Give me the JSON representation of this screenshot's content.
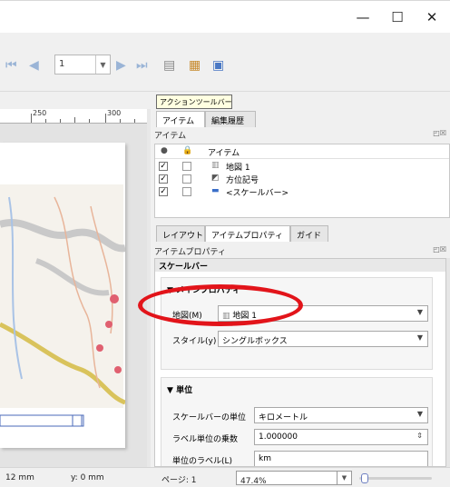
{
  "window": {
    "minimize_glyph": "—",
    "maximize_glyph": "☐",
    "close_glyph": "✕"
  },
  "toolbar": {
    "page_value": "1",
    "icons": [
      "first-page-icon",
      "previous-page-icon",
      "next-page-icon",
      "last-page-icon",
      "print-icon",
      "atlas-export-icon",
      "atlas-settings-icon"
    ]
  },
  "tooltip": {
    "text": "アクションツールバー"
  },
  "ruler": {
    "labels": [
      "250",
      "300"
    ]
  },
  "items_panel": {
    "tabs": [
      "アイテム",
      "編集履歴"
    ],
    "title": "アイテム",
    "column_header": "アイテム",
    "rows": [
      {
        "label": "地図 1",
        "icon": "map-item-icon",
        "visible": "✓"
      },
      {
        "label": "方位記号",
        "icon": "north-arrow-item-icon",
        "visible": "✓"
      },
      {
        "label": "<スケールバー>",
        "icon": "scalebar-item-icon",
        "visible": "✓"
      }
    ]
  },
  "props_panel": {
    "tabs": [
      "レイアウト",
      "アイテムプロパティ",
      "ガイド"
    ],
    "title": "アイテムプロパティ",
    "section": "スケールバー",
    "main_group": {
      "title": "メインプロパティ",
      "map_label": "地図(M)",
      "map_value": "地図 1",
      "style_label": "スタイル(y)",
      "style_value": "シングルボックス"
    },
    "units_group": {
      "title": "単位",
      "unit_label": "スケールバーの単位",
      "unit_value": "キロメートル",
      "multiplier_label": "ラベル単位の乗数",
      "multiplier_value": "1.000000",
      "label_label": "単位のラベル(L)",
      "label_value": "km"
    }
  },
  "statusbar": {
    "x": "12 mm",
    "y": "y: 0 mm",
    "page": "ページ: 1",
    "zoom": "47.4%"
  },
  "colors": {
    "highlight_ellipse": "#e2141a",
    "tooltip_bg": "#ffffe1"
  }
}
